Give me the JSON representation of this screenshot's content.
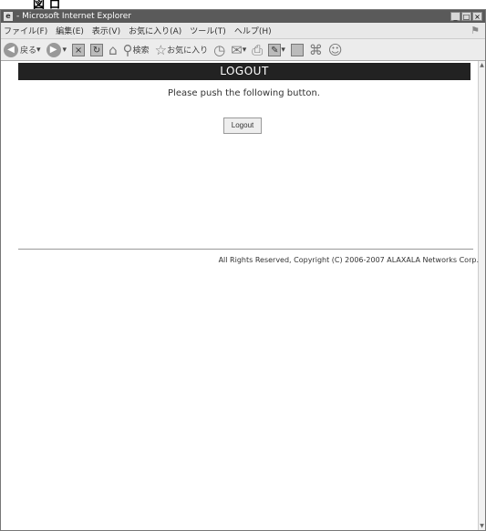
{
  "caption": "図 ロ",
  "window": {
    "title": "- Microsoft Internet Explorer",
    "controls": [
      "_",
      "□",
      "×"
    ]
  },
  "menubar": {
    "items": [
      "ファイル(F)",
      "編集(E)",
      "表示(V)",
      "お気に入り(A)",
      "ツール(T)",
      "ヘルプ(H)"
    ]
  },
  "toolbar": {
    "back_label": "戻る",
    "search_label": "検索",
    "favorites_label": "お気に入り"
  },
  "page": {
    "banner": "LOGOUT",
    "message": "Please push the following button.",
    "button_label": "Logout",
    "footer": "All Rights Reserved, Copyright (C) 2006-2007 ALAXALA Networks Corp."
  }
}
